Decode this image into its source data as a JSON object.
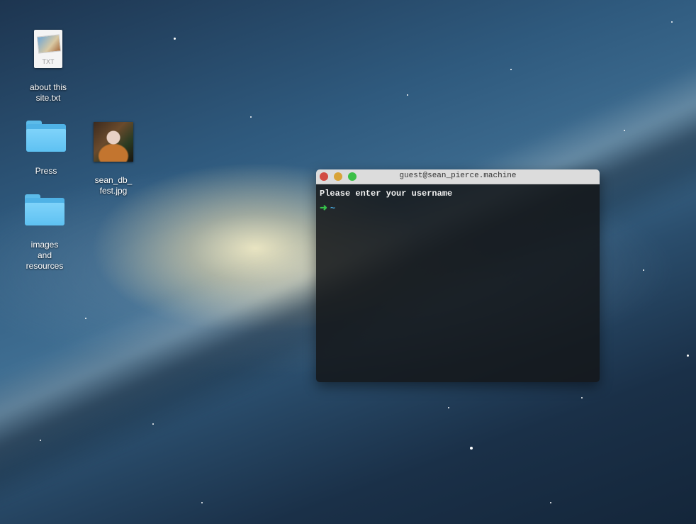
{
  "desktop": {
    "icons": [
      {
        "name": "about this site.txt",
        "label": "about this site.txt",
        "type": "text-document-icon",
        "badge": "TXT"
      },
      {
        "name": "Press",
        "label": "Press",
        "type": "folder-icon"
      },
      {
        "name": "sean_db_fest.jpg",
        "label": "sean_db_ fest.jpg",
        "type": "image-thumbnail-icon"
      },
      {
        "name": "images and resources",
        "label": "images and resources",
        "type": "folder-icon"
      }
    ]
  },
  "terminal": {
    "title": "guest@sean_pierce.machine",
    "lines": [
      {
        "text": "Please enter your username"
      }
    ],
    "prompt": {
      "arrow": "➜",
      "path": "~"
    },
    "colors": {
      "prompt_arrow": "#36c24a",
      "prompt_path": "#4ab0e8",
      "close": "#d24b43",
      "minimize": "#d8a338",
      "maximize": "#3bbf46"
    }
  }
}
